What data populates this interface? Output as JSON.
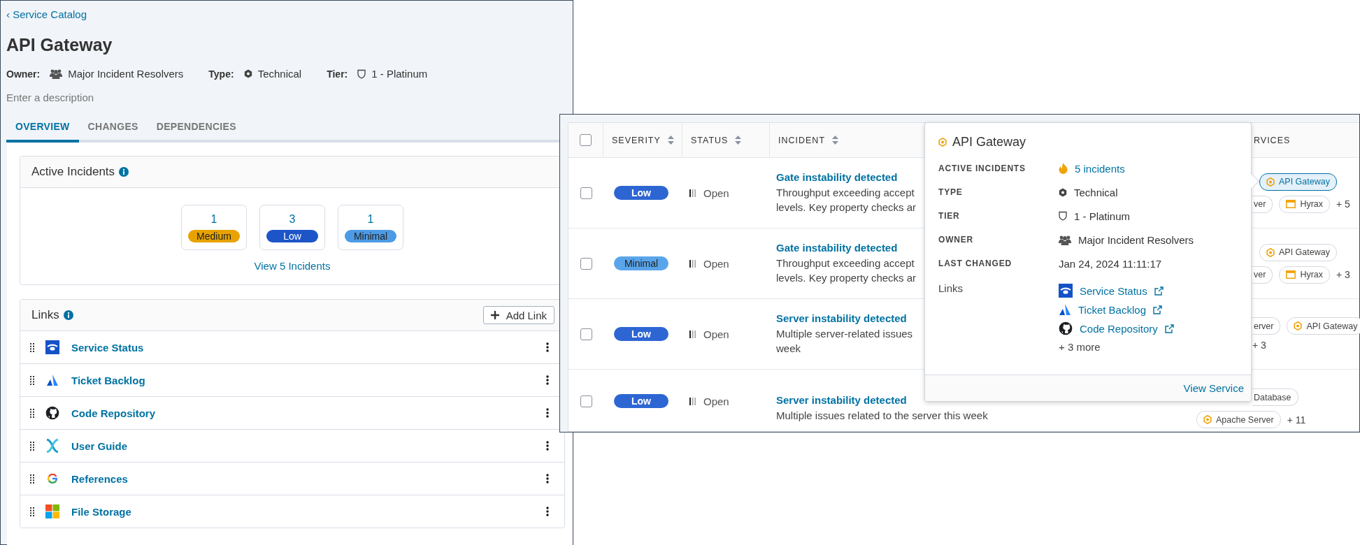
{
  "catalog_page": {
    "breadcrumb": "‹ Service Catalog",
    "title": "API Gateway",
    "meta": [
      {
        "label": "Owner:",
        "value": "Major Incident Resolvers",
        "kind": "owner"
      },
      {
        "label": "Type:",
        "value": "Technical",
        "kind": "type"
      },
      {
        "label": "Tier:",
        "value": "1 - Platinum",
        "kind": "tier"
      }
    ],
    "description": {
      "placeholder": "Enter a description"
    },
    "tabs": [
      {
        "label": "OVERVIEW",
        "selected": true
      },
      {
        "label": "CHANGES",
        "selected": false
      },
      {
        "label": "DEPENDENCIES",
        "selected": false
      }
    ],
    "active_incidents": {
      "title": "Active Incidents",
      "counts": [
        {
          "count": "1",
          "severity": "Medium",
          "color": "#e8a300"
        },
        {
          "count": "3",
          "severity": "Low",
          "color": "#1d55c9"
        },
        {
          "count": "1",
          "severity": "Minimal",
          "color": "#4d9be6"
        }
      ],
      "link": "View 5 Incidents"
    },
    "links": {
      "title": "Links",
      "add_button": "Add Link",
      "items": [
        {
          "label": "Service Status",
          "kind": "status"
        },
        {
          "label": "Ticket Backlog",
          "kind": "backlog"
        },
        {
          "label": "Code Repository",
          "kind": "repo"
        },
        {
          "label": "User Guide",
          "kind": "guide"
        },
        {
          "label": "References",
          "kind": "search"
        },
        {
          "label": "File Storage",
          "kind": "storage"
        }
      ]
    }
  },
  "incident_table": {
    "select_all": {
      "checked": false
    },
    "columns": [
      {
        "label": "SEVERITY",
        "sortable": true
      },
      {
        "label": "STATUS",
        "sortable": true
      },
      {
        "label": "INCIDENT",
        "sortable": true
      },
      {
        "label": "RVICES",
        "sortable": false
      }
    ],
    "rows": [
      {
        "checked": false,
        "severity": "Low",
        "color": "#2d66d3",
        "status": "Open",
        "title": "Gate instability detected",
        "description": [
          "Throughput exceeding accept",
          "levels. Key property checks ar"
        ],
        "services": [
          [
            {
              "kind": "service",
              "label": "API Gateway",
              "selected": true
            }
          ],
          [
            {
              "kind": "partial",
              "label": "ver",
              "selected": false
            },
            {
              "kind": "app",
              "label": "Hyrax",
              "selected": false
            },
            {
              "kind": "more",
              "label": "+ 5"
            }
          ]
        ]
      },
      {
        "checked": false,
        "severity": "Minimal",
        "color": "#5aa5ea",
        "status": "Open",
        "title": "Gate instability detected",
        "description": [
          "Throughput exceeding accept",
          "levels. Key property checks ar"
        ],
        "services": [
          [
            {
              "kind": "service",
              "label": "API Gateway",
              "selected": false
            }
          ],
          [
            {
              "kind": "partial",
              "label": "ver",
              "selected": false
            },
            {
              "kind": "app",
              "label": "Hyrax",
              "selected": false
            },
            {
              "kind": "more",
              "label": "+ 3"
            }
          ]
        ]
      },
      {
        "checked": false,
        "severity": "Low",
        "color": "#2d66d3",
        "status": "Open",
        "title": "Server instability detected",
        "description": [
          "Multiple server-related issues",
          "week"
        ],
        "services": [
          [
            {
              "kind": "partial",
              "label": "erver",
              "selected": false
            },
            {
              "kind": "service",
              "label": "API Gateway",
              "selected": false
            }
          ],
          [
            {
              "kind": "more",
              "label": "+ 3"
            }
          ]
        ]
      },
      {
        "checked": false,
        "severity": "Low",
        "color": "#2d66d3",
        "status": "Open",
        "title": "Server instability detected",
        "description": [
          "Multiple issues related to the server this week"
        ],
        "services": [
          [
            {
              "kind": "partial",
              "label": "Database",
              "selected": false
            }
          ],
          [
            {
              "kind": "service",
              "label": "Apache Server",
              "selected": false
            },
            {
              "kind": "more",
              "label": "+ 11"
            }
          ]
        ]
      }
    ]
  },
  "service_popover": {
    "title": "API Gateway",
    "fields": [
      {
        "label": "ACTIVE INCIDENTS",
        "value": "5 incidents",
        "kind": "incidents"
      },
      {
        "label": "TYPE",
        "value": "Technical",
        "kind": "type"
      },
      {
        "label": "TIER",
        "value": "1 - Platinum",
        "kind": "tier"
      },
      {
        "label": "OWNER",
        "value": "Major Incident Resolvers",
        "kind": "owner"
      },
      {
        "label": "LAST CHANGED",
        "value": "Jan 24, 2024 11:11:17",
        "kind": "date"
      }
    ],
    "links_label": "Links",
    "links": [
      {
        "label": "Service Status",
        "kind": "status"
      },
      {
        "label": "Ticket Backlog",
        "kind": "backlog"
      },
      {
        "label": "Code Repository",
        "kind": "repo"
      }
    ],
    "more_links": "+ 3 more",
    "footer_link": "View Service"
  }
}
